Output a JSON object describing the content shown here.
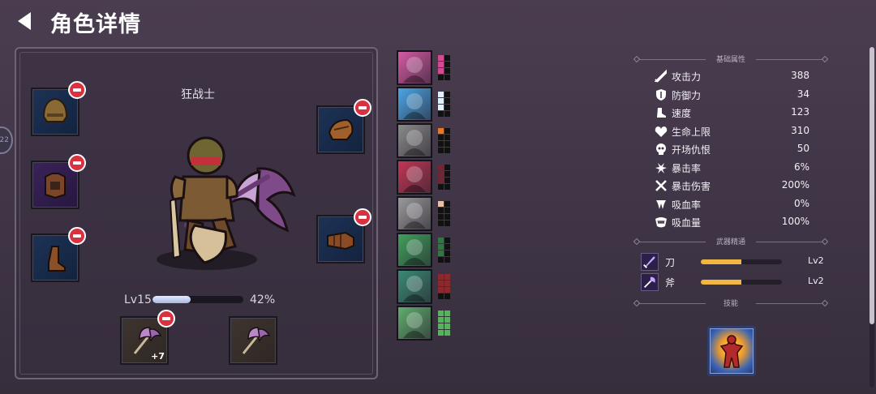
{
  "header": {
    "title": "角色详情",
    "back_icon": "back-arrow-icon"
  },
  "side_tab": {
    "label": "22"
  },
  "hero": {
    "name": "狂战士",
    "level_label": "Lv15",
    "xp_fraction": 0.42,
    "xp_percent_label": "42%",
    "equipment": {
      "left": [
        {
          "icon": "helmet-icon",
          "rarity": "blue"
        },
        {
          "icon": "armor-icon",
          "rarity": "purple"
        },
        {
          "icon": "boots-icon",
          "rarity": "blue"
        }
      ],
      "right": [
        {
          "icon": "shoulder-icon",
          "rarity": "blue"
        },
        {
          "icon": "gauntlet-icon",
          "rarity": "blue"
        }
      ]
    },
    "weapons": [
      {
        "icon": "axe-weapon-icon",
        "upgrade": "+7",
        "equipped": true
      },
      {
        "icon": "axe-weapon-icon",
        "upgrade": "",
        "equipped": false
      }
    ]
  },
  "team": [
    {
      "name": "claw-portrait",
      "bg": "#d45aa3",
      "grid": [
        "#d04b8f",
        "#111",
        "#d04b8f",
        "#111",
        "#d04b8f",
        "#111",
        "#111",
        "#111"
      ]
    },
    {
      "name": "angel-portrait",
      "bg": "#4aa6e6",
      "grid": [
        "#dff0ff",
        "#111",
        "#dff0ff",
        "#111",
        "#dff0ff",
        "#111",
        "#111",
        "#111"
      ]
    },
    {
      "name": "skeleton-portrait",
      "bg": "#8a8a8a",
      "grid": [
        "#e07a2e",
        "#111",
        "#111",
        "#111",
        "#111",
        "#111",
        "#111",
        "#111"
      ]
    },
    {
      "name": "beast-portrait",
      "bg": "#c23654",
      "grid": [
        "#7a2230",
        "#111",
        "#7a2230",
        "#111",
        "#7a2230",
        "#111",
        "#111",
        "#111"
      ]
    },
    {
      "name": "ghost-portrait",
      "bg": "#9a9a9a",
      "grid": [
        "#e8c2a8",
        "#111",
        "#111",
        "#111",
        "#111",
        "#111",
        "#111",
        "#111"
      ]
    },
    {
      "name": "monk-portrait",
      "bg": "#3fa15c",
      "grid": [
        "#2c7a3e",
        "#111",
        "#2c7a3e",
        "#111",
        "#2c7a3e",
        "#111",
        "#111",
        "#111"
      ]
    },
    {
      "name": "warrior-portrait",
      "bg": "#3a8a75",
      "grid": [
        "#8a2a2e",
        "#8a2a2e",
        "#8a2a2e",
        "#8a2a2e",
        "#8a2a2e",
        "#8a2a2e",
        "#111",
        "#111"
      ]
    },
    {
      "name": "mage-portrait",
      "bg": "#5fae6e",
      "grid": [
        "#58b35e",
        "#58b35e",
        "#58b35e",
        "#58b35e",
        "#58b35e",
        "#58b35e",
        "#58b35e",
        "#58b35e"
      ]
    }
  ],
  "stats": {
    "section_title": "基础属性",
    "items": [
      {
        "icon": "sword-icon",
        "label": "攻击力",
        "value": "388"
      },
      {
        "icon": "shield-icon",
        "label": "防御力",
        "value": "34"
      },
      {
        "icon": "boot-speed-icon",
        "label": "速度",
        "value": "123"
      },
      {
        "icon": "heart-icon",
        "label": "生命上限",
        "value": "310"
      },
      {
        "icon": "skull-icon",
        "label": "开场仇恨",
        "value": "50"
      },
      {
        "icon": "burst-icon",
        "label": "暴击率",
        "value": "6%"
      },
      {
        "icon": "crossed-swords-icon",
        "label": "暴击伤害",
        "value": "200%"
      },
      {
        "icon": "fang-icon",
        "label": "吸血率",
        "value": "0%"
      },
      {
        "icon": "jaw-icon",
        "label": "吸血量",
        "value": "100%"
      }
    ]
  },
  "mastery": {
    "section_title": "武器精通",
    "items": [
      {
        "icon": "blade-icon",
        "label": "刀",
        "fraction": 0.5,
        "level": "Lv2"
      },
      {
        "icon": "axe-icon",
        "label": "斧",
        "fraction": 0.5,
        "level": "Lv2"
      }
    ]
  },
  "skills": {
    "section_title": "技能",
    "items": [
      {
        "icon": "rage-skill-icon"
      }
    ]
  },
  "colors": {
    "accent_red": "#d8313f",
    "mastery_bar": "#f0b743",
    "xp_bar": "#c9d6f2"
  }
}
